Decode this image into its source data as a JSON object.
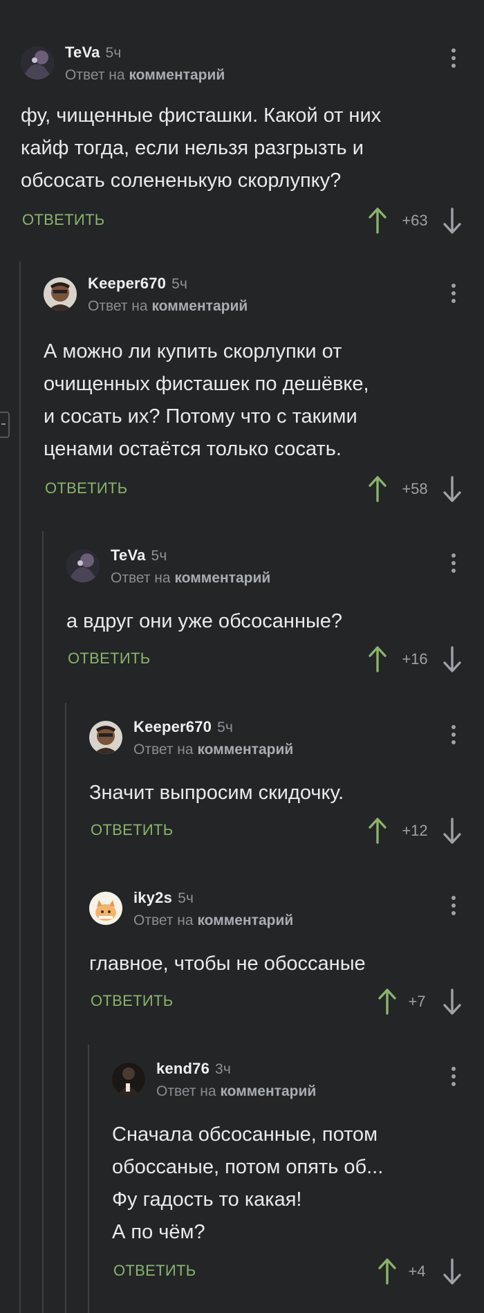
{
  "colors": {
    "background": "#232527",
    "accent_green": "#8ab46a",
    "downvote": "#9ea2a6",
    "thread_line": "#3d4044"
  },
  "reply_prefix": "Ответ на",
  "reply_target": "комментарий",
  "answer_label": "ОТВЕТИТЬ",
  "comments": [
    {
      "author": "TeVa",
      "time": "5ч",
      "text": "фу, чищенные фисташки. Какой от них\nкайф тогда, если нельзя разгрызть и\nобсосать солененькую скорлупку?",
      "score": "+63",
      "avatar_icon": "dark-photo-avatar"
    },
    {
      "author": "Keeper670",
      "time": "5ч",
      "text": "А можно ли купить скорлупки от\nочищенных фисташек по дешёвке,\nи сосать их? Потому что с такими\nценами остаётся только сосать.",
      "score": "+58",
      "avatar_icon": "man-portrait-avatar"
    },
    {
      "author": "TeVa",
      "time": "5ч",
      "text": "а вдруг они уже обсосанные?",
      "score": "+16",
      "avatar_icon": "dark-photo-avatar"
    },
    {
      "author": "Keeper670",
      "time": "5ч",
      "text": "Значит выпросим скидочку.",
      "score": "+12",
      "avatar_icon": "man-portrait-avatar"
    },
    {
      "author": "iky2s",
      "time": "5ч",
      "text": "главное, чтобы не обоссаные",
      "score": "+7",
      "avatar_icon": "cartoon-cat-avatar"
    },
    {
      "author": "kend76",
      "time": "3ч",
      "text": "Сначала обсосанные, потом\nобоссаные, потом опять об...\nФу гадость то какая!\nА по чём?",
      "score": "+4",
      "avatar_icon": "dark-figure-avatar"
    }
  ]
}
